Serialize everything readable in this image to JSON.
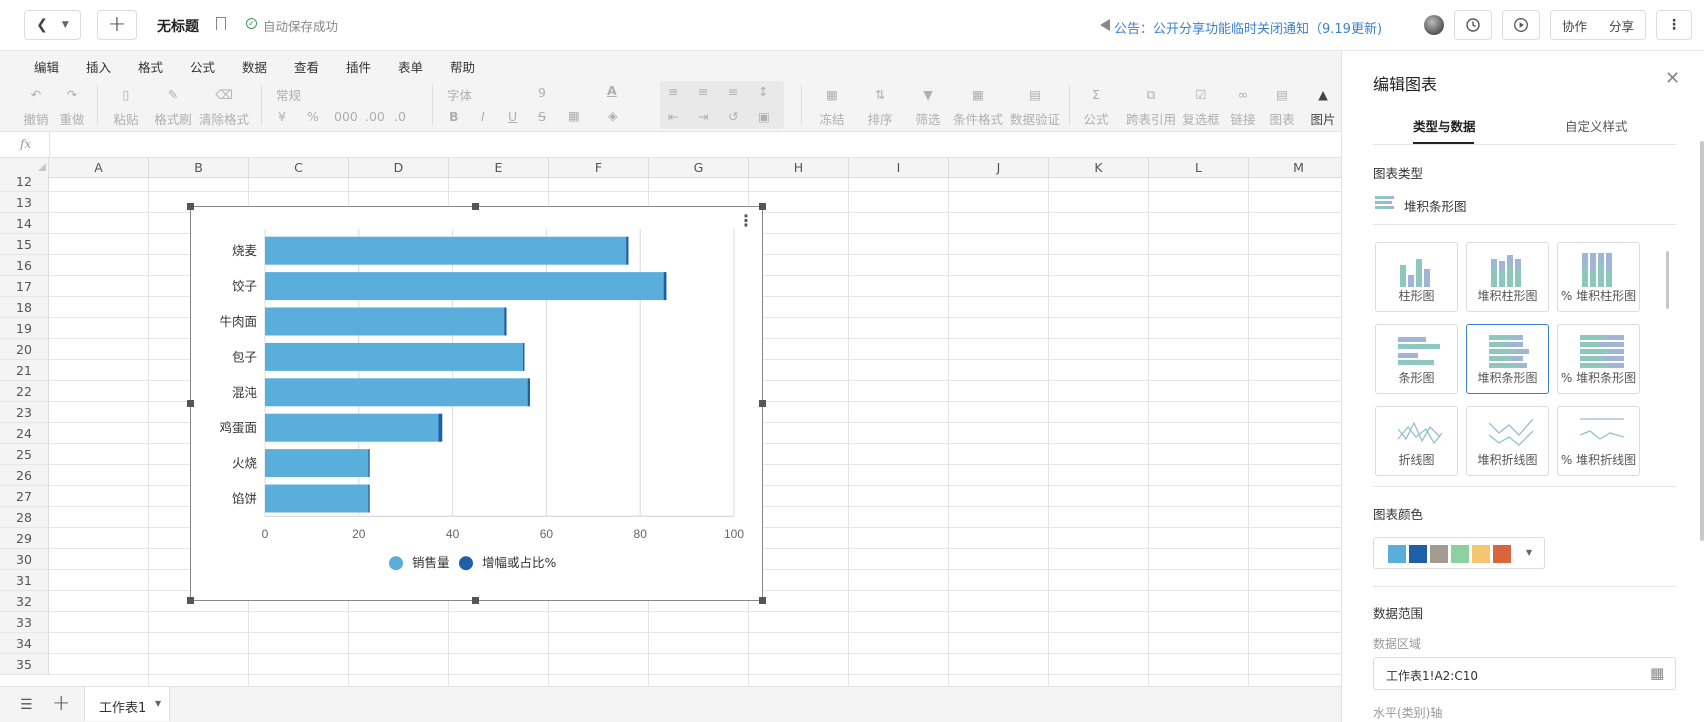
{
  "topbar": {
    "doc_title": "无标题",
    "autosave": "自动保存成功",
    "announcement": "公告：公开分享功能临时关闭通知（9.19更新)",
    "collab_label": "协作",
    "share_label": "分享"
  },
  "menu": [
    "编辑",
    "插入",
    "格式",
    "公式",
    "数据",
    "查看",
    "插件",
    "表单",
    "帮助"
  ],
  "toolbar": {
    "undo": "撤销",
    "redo": "重做",
    "paste": "粘贴",
    "format_painter": "格式刷",
    "clear_format": "清除格式",
    "number_format": "常规",
    "currency": "¥",
    "percent": "%",
    "thousands": "000",
    "dec_inc": ".00",
    "dec_dec": ".0",
    "font": "字体",
    "font_size": "9",
    "freeze": "冻结",
    "sort": "排序",
    "filter": "筛选",
    "cond_format": "条件格式",
    "data_validation": "数据验证",
    "formula": "公式",
    "cross_ref": "跨表引用",
    "checkbox": "复选框",
    "link": "链接",
    "chart": "图表",
    "image": "图片"
  },
  "formula_bar": {
    "fx": "fx",
    "value": ""
  },
  "grid": {
    "columns": [
      "A",
      "B",
      "C",
      "D",
      "E",
      "F",
      "G",
      "H",
      "I",
      "J",
      "K",
      "L",
      "M"
    ],
    "rows": [
      "12",
      "13",
      "14",
      "15",
      "16",
      "17",
      "18",
      "19",
      "20",
      "21",
      "22",
      "23",
      "24",
      "25",
      "26",
      "27",
      "28",
      "29",
      "30",
      "31",
      "32",
      "33",
      "34",
      "35"
    ]
  },
  "chart_data": {
    "type": "bar",
    "orientation": "horizontal",
    "stacked": true,
    "categories": [
      "烧麦",
      "饺子",
      "牛肉面",
      "包子",
      "混沌",
      "鸡蛋面",
      "火烧",
      "馅饼"
    ],
    "series": [
      {
        "name": "销售量",
        "values": [
          77,
          85,
          51,
          55,
          56,
          37,
          22,
          22
        ],
        "color": "#59aedb"
      },
      {
        "name": "增幅或占比%",
        "values": [
          0.5,
          0.6,
          0.5,
          0.2,
          0.5,
          0.8,
          0.2,
          0.2
        ],
        "color": "#1f5fa8"
      }
    ],
    "xlim": [
      0,
      100
    ],
    "xticks": [
      "0",
      "20",
      "40",
      "60",
      "80",
      "100"
    ],
    "grid": true,
    "legend": "bottom"
  },
  "bottombar": {
    "sheet_tab": "工作表1"
  },
  "panel": {
    "title": "编辑图表",
    "tab_type_data": "类型与数据",
    "tab_custom_style": "自定义样式",
    "chart_type_heading": "图表类型",
    "current_type": "堆积条形图",
    "types": [
      "柱形图",
      "堆积柱形图",
      "% 堆积柱形图",
      "条形图",
      "堆积条形图",
      "% 堆积条形图",
      "折线图",
      "堆积折线图",
      "% 堆积折线图"
    ],
    "chart_color_heading": "图表颜色",
    "palette": [
      "#59aedb",
      "#1f5fa8",
      "#a39a91",
      "#8ed1a0",
      "#f6c572",
      "#d9653f"
    ],
    "data_range_heading": "数据范围",
    "data_area_label": "数据区域",
    "data_area_value": "工作表1!A2:C10",
    "horizontal_axis_label": "水平(类别)轴"
  }
}
